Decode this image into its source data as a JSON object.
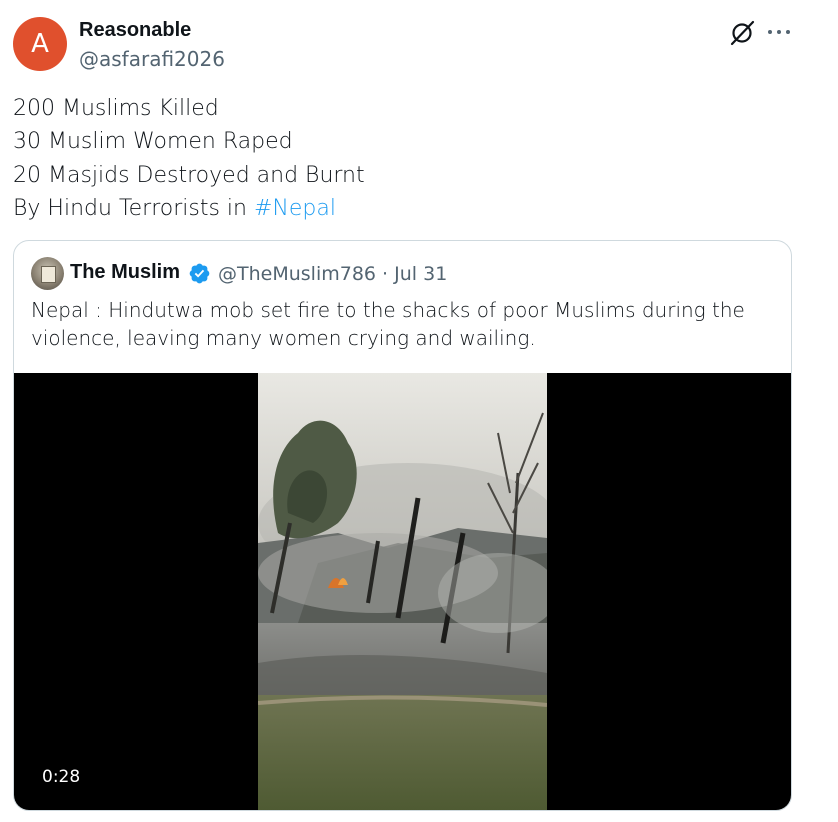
{
  "author": {
    "avatar_letter": "A",
    "avatar_color": "#e0502d",
    "display_name": "Reasonable",
    "handle": "@asfarafi2026"
  },
  "header_icons": [
    "grok-icon",
    "more-options-icon"
  ],
  "tweet": {
    "lines": [
      "200 Muslims Killed",
      "30 Muslim Women Raped",
      "20 Masjids Destroyed and Burnt"
    ],
    "last_line_prefix": "By Hindu Terrorists in ",
    "hashtag": "#Nepal"
  },
  "quoted_tweet": {
    "display_name": "The Muslim",
    "verified": true,
    "handle": "@TheMuslim786",
    "separator": " · ",
    "date": "Jul 31",
    "text": "Nepal : Hindutwa mob set fire to the shacks of poor Muslims during the violence, leaving many women crying and wailing.",
    "video": {
      "duration": "0:28",
      "description_icon": "video-thumbnail"
    }
  },
  "colors": {
    "link": "#1d9bf0",
    "secondary_text": "#536471",
    "border": "#cfd9de",
    "verified_badge": "#1d9bf0"
  }
}
